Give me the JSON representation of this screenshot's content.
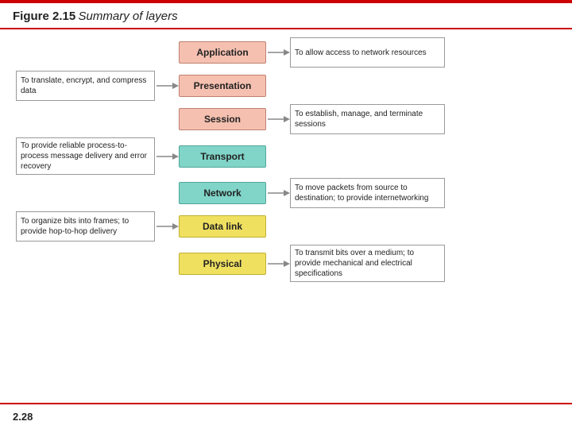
{
  "header": {
    "figure_label": "Figure 2.15",
    "figure_title": "Summary of layers"
  },
  "layers": [
    {
      "name": "Application",
      "color_class": "layer-application",
      "left_desc": "",
      "right_desc": "To allow access to network resources"
    },
    {
      "name": "Presentation",
      "color_class": "layer-presentation",
      "left_desc": "To translate, encrypt, and compress data",
      "right_desc": ""
    },
    {
      "name": "Session",
      "color_class": "layer-session",
      "left_desc": "",
      "right_desc": "To establish, manage, and terminate sessions"
    },
    {
      "name": "Transport",
      "color_class": "layer-transport",
      "left_desc": "To provide reliable process-to-process message delivery and error recovery",
      "right_desc": ""
    },
    {
      "name": "Network",
      "color_class": "layer-network",
      "left_desc": "",
      "right_desc": "To move packets from source to destination; to provide internetworking"
    },
    {
      "name": "Data link",
      "color_class": "layer-datalink",
      "left_desc": "To organize bits into frames; to provide hop-to-hop delivery",
      "right_desc": ""
    },
    {
      "name": "Physical",
      "color_class": "layer-physical",
      "left_desc": "",
      "right_desc": "To transmit bits over a medium; to provide mechanical and electrical specifications"
    }
  ],
  "footer": {
    "page_number": "2.28"
  }
}
